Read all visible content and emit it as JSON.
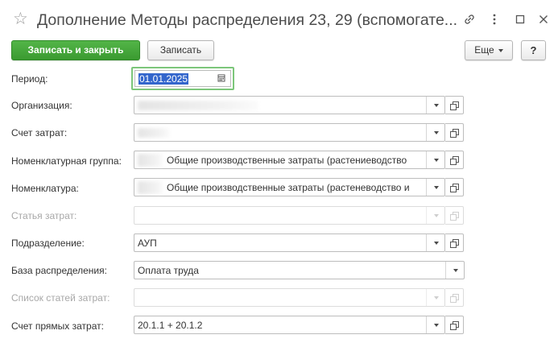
{
  "window": {
    "title": "Дополнение Методы распределения 23, 29 (вспомогате...",
    "icons": [
      "star-icon",
      "link-icon",
      "more-icon",
      "maximize-icon",
      "close-icon"
    ]
  },
  "toolbar": {
    "save_close_label": "Записать и закрыть",
    "save_label": "Записать",
    "more_label": "Еще",
    "help_label": "?"
  },
  "form": {
    "period": {
      "label": "Период:",
      "value": "01.01.2025"
    },
    "organization": {
      "label": "Организация:",
      "value": ""
    },
    "cost_account": {
      "label": "Счет затрат:",
      "value": ""
    },
    "nomenclature_group": {
      "label": "Номенклатурная группа:",
      "value": "Общие производственные затраты (растениеводство"
    },
    "nomenclature": {
      "label": "Номенклатура:",
      "value": "Общие производственные затраты (растеневодство и"
    },
    "cost_item": {
      "label": "Статья затрат:",
      "value": ""
    },
    "department": {
      "label": "Подразделение:",
      "value": "АУП"
    },
    "distribution_base": {
      "label": "База распределения:",
      "value": "Оплата труда"
    },
    "cost_items_list": {
      "label": "Список статей затрат:",
      "value": ""
    },
    "direct_cost_account": {
      "label": "Счет прямых затрат:",
      "value": "20.1.1 + 20.1.2"
    }
  },
  "colors": {
    "primary": "#3fa035",
    "focus": "#7cc67a",
    "selection": "#3366cc"
  }
}
